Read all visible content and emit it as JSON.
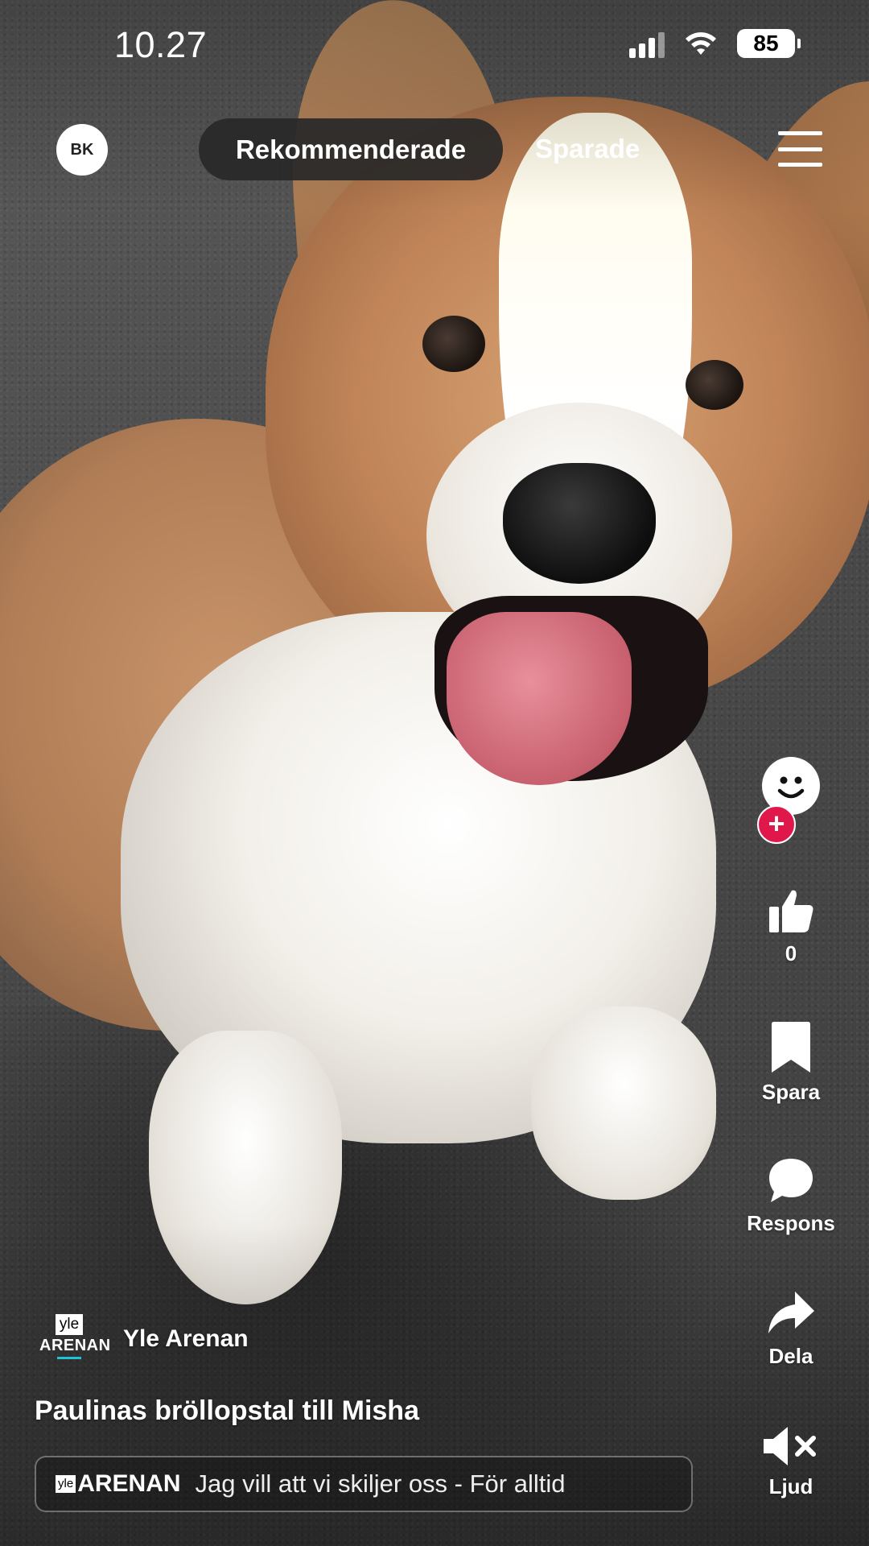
{
  "status_bar": {
    "time": "10.27",
    "battery": "85"
  },
  "top_nav": {
    "avatar_initials": "BK",
    "tabs": [
      {
        "label": "Rekommenderade",
        "active": true
      },
      {
        "label": "Sparade",
        "active": false
      }
    ]
  },
  "actions": {
    "like_count": "0",
    "save_label": "Spara",
    "respond_label": "Respons",
    "share_label": "Dela",
    "sound_label": "Ljud"
  },
  "video": {
    "channel_logo_top": "yle",
    "channel_logo_bottom": "ARENAN",
    "channel_name": "Yle Arenan",
    "title": "Paulinas bröllopstal till Misha"
  },
  "program_bar": {
    "logo_small": "yle",
    "logo_word": "ARENAN",
    "text": "Jag vill att vi skiljer oss - För alltid"
  },
  "colors": {
    "accent_pink": "#e0174a",
    "arena_cyan": "#1bc5d5"
  },
  "icons": [
    "wifi-icon",
    "signal-icon",
    "battery-icon",
    "menu-icon",
    "smiley-icon",
    "plus-icon",
    "thumbs-up-icon",
    "bookmark-icon",
    "chat-bubble-icon",
    "share-arrow-icon",
    "speaker-muted-icon"
  ]
}
